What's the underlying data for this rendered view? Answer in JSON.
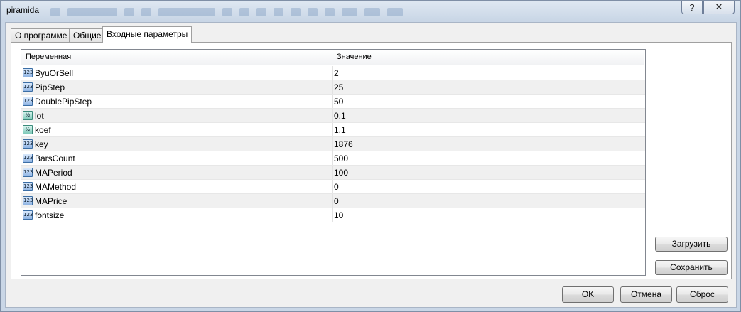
{
  "window": {
    "title": "piramida",
    "help_label": "?",
    "close_label": "✕"
  },
  "tabs": [
    {
      "label": "О программе",
      "active": false
    },
    {
      "label": "Общие",
      "active": false
    },
    {
      "label": "Входные параметры",
      "active": true
    }
  ],
  "table": {
    "headers": [
      "Переменная",
      "Значение"
    ],
    "rows": [
      {
        "name": "ByuOrSell",
        "value": "2",
        "type_icon": "int-type-icon",
        "icon_text": "123"
      },
      {
        "name": "PipStep",
        "value": "25",
        "type_icon": "int-type-icon",
        "icon_text": "123"
      },
      {
        "name": "DoublePipStep",
        "value": "50",
        "type_icon": "int-type-icon",
        "icon_text": "123"
      },
      {
        "name": "lot",
        "value": "0.1",
        "type_icon": "double-type-icon",
        "icon_text": "½"
      },
      {
        "name": "koef",
        "value": "1.1",
        "type_icon": "double-type-icon",
        "icon_text": "½"
      },
      {
        "name": "key",
        "value": "1876",
        "type_icon": "int-type-icon",
        "icon_text": "123"
      },
      {
        "name": "BarsCount",
        "value": "500",
        "type_icon": "int-type-icon",
        "icon_text": "123"
      },
      {
        "name": "MAPeriod",
        "value": "100",
        "type_icon": "int-type-icon",
        "icon_text": "123"
      },
      {
        "name": "MAMethod",
        "value": "0",
        "type_icon": "int-type-icon",
        "icon_text": "123"
      },
      {
        "name": "MAPrice",
        "value": "0",
        "type_icon": "int-type-icon",
        "icon_text": "123"
      },
      {
        "name": "fontsize",
        "value": "10",
        "type_icon": "int-type-icon",
        "icon_text": "123"
      }
    ]
  },
  "side_buttons": {
    "load_label": "Загрузить",
    "save_label": "Сохранить"
  },
  "dialog_buttons": {
    "ok_label": "OK",
    "cancel_label": "Отмена",
    "reset_label": "Сброс"
  }
}
